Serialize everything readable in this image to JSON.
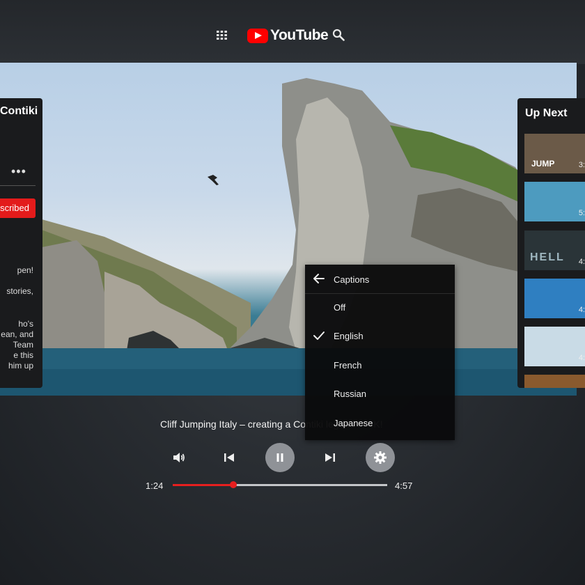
{
  "header": {
    "logo_text": "YouTube",
    "icons": [
      "apps-icon",
      "search-icon"
    ],
    "brand_color": "#ff0000"
  },
  "channel_panel": {
    "channel_name": "Contiki",
    "more_icon": "•••",
    "subscribe_label": "scribed",
    "description_lines": [
      "pen!",
      "stories,",
      "ho's",
      "ean, and",
      "Team",
      "e this",
      "him up"
    ]
  },
  "up_next": {
    "title": "Up Next",
    "items": [
      {
        "overlay_text": "JUMP",
        "duration": "3:",
        "color": "#6b5a48"
      },
      {
        "overlay_text": "",
        "duration": "5:",
        "color": "#4d9bbf"
      },
      {
        "overlay_text": "HELL",
        "duration": "4:",
        "color": "#2a3438"
      },
      {
        "overlay_text": "",
        "duration": "4:",
        "color": "#2f7fc1"
      },
      {
        "overlay_text": "",
        "duration": "4:",
        "color": "#c9dbe6"
      },
      {
        "overlay_text": "",
        "duration": "",
        "color": "#8a5a2e"
      }
    ]
  },
  "captions_menu": {
    "title": "Captions",
    "options": [
      {
        "label": "Off",
        "selected": false
      },
      {
        "label": "English",
        "selected": true
      },
      {
        "label": "French",
        "selected": false
      },
      {
        "label": "Russian",
        "selected": false
      },
      {
        "label": "Japanese",
        "selected": false
      }
    ]
  },
  "player": {
    "video_title": "Cliff Jumping Italy – creating a Contiki legend in 4K!",
    "current_time": "1:24",
    "total_time": "4:57",
    "progress_fraction": 0.2828,
    "accent_color": "#e61f1f",
    "controls": [
      "volume-icon",
      "previous-icon",
      "pause-icon",
      "next-icon",
      "settings-icon"
    ]
  }
}
